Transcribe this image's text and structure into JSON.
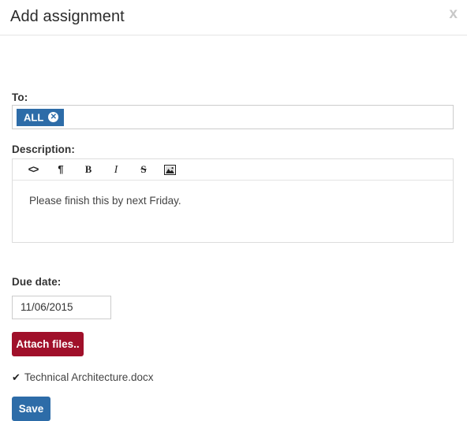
{
  "dialog": {
    "title": "Add assignment",
    "close_label": "x"
  },
  "form": {
    "to": {
      "label": "To:",
      "tags": [
        {
          "label": "ALL",
          "remove_label": "✕"
        }
      ],
      "placeholder": ""
    },
    "description": {
      "label": "Description:",
      "toolbar": [
        {
          "name": "code-icon",
          "glyph": "<>"
        },
        {
          "name": "paragraph-icon",
          "glyph": "¶"
        },
        {
          "name": "bold-icon",
          "glyph": "B"
        },
        {
          "name": "italic-icon",
          "glyph": "I"
        },
        {
          "name": "strikethrough-icon",
          "glyph": "S"
        },
        {
          "name": "image-icon",
          "glyph": ""
        }
      ],
      "value": "Please finish this by next Friday."
    },
    "due_date": {
      "label": "Due date:",
      "value": "11/06/2015",
      "placeholder": "mm/dd/yyyy"
    },
    "attach": {
      "button_label": "Attach files..",
      "files": [
        {
          "check": "✔",
          "name": "Technical Architecture.docx"
        }
      ]
    },
    "save_label": "Save"
  },
  "colors": {
    "primary": "#2d6ca8",
    "danger": "#a0102a",
    "border": "#cccccc",
    "text": "#333333"
  }
}
